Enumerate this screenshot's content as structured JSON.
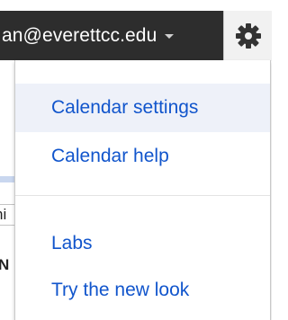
{
  "account": {
    "email": "an@everettcc.edu"
  },
  "background": {
    "fragment_1": "ni",
    "fragment_2": "N"
  },
  "settings_menu": {
    "items": [
      {
        "label": "Calendar settings",
        "highlighted": true
      },
      {
        "label": "Calendar help",
        "highlighted": false
      },
      {
        "label": "Labs",
        "highlighted": false
      },
      {
        "label": "Try the new look",
        "highlighted": false
      }
    ]
  },
  "icons": {
    "settings": "gear-icon",
    "account_dropdown": "chevron-down-icon"
  },
  "colors": {
    "link": "#1155cc",
    "account_bar": "#2d2d2d",
    "hover_row": "#eef1f9"
  }
}
